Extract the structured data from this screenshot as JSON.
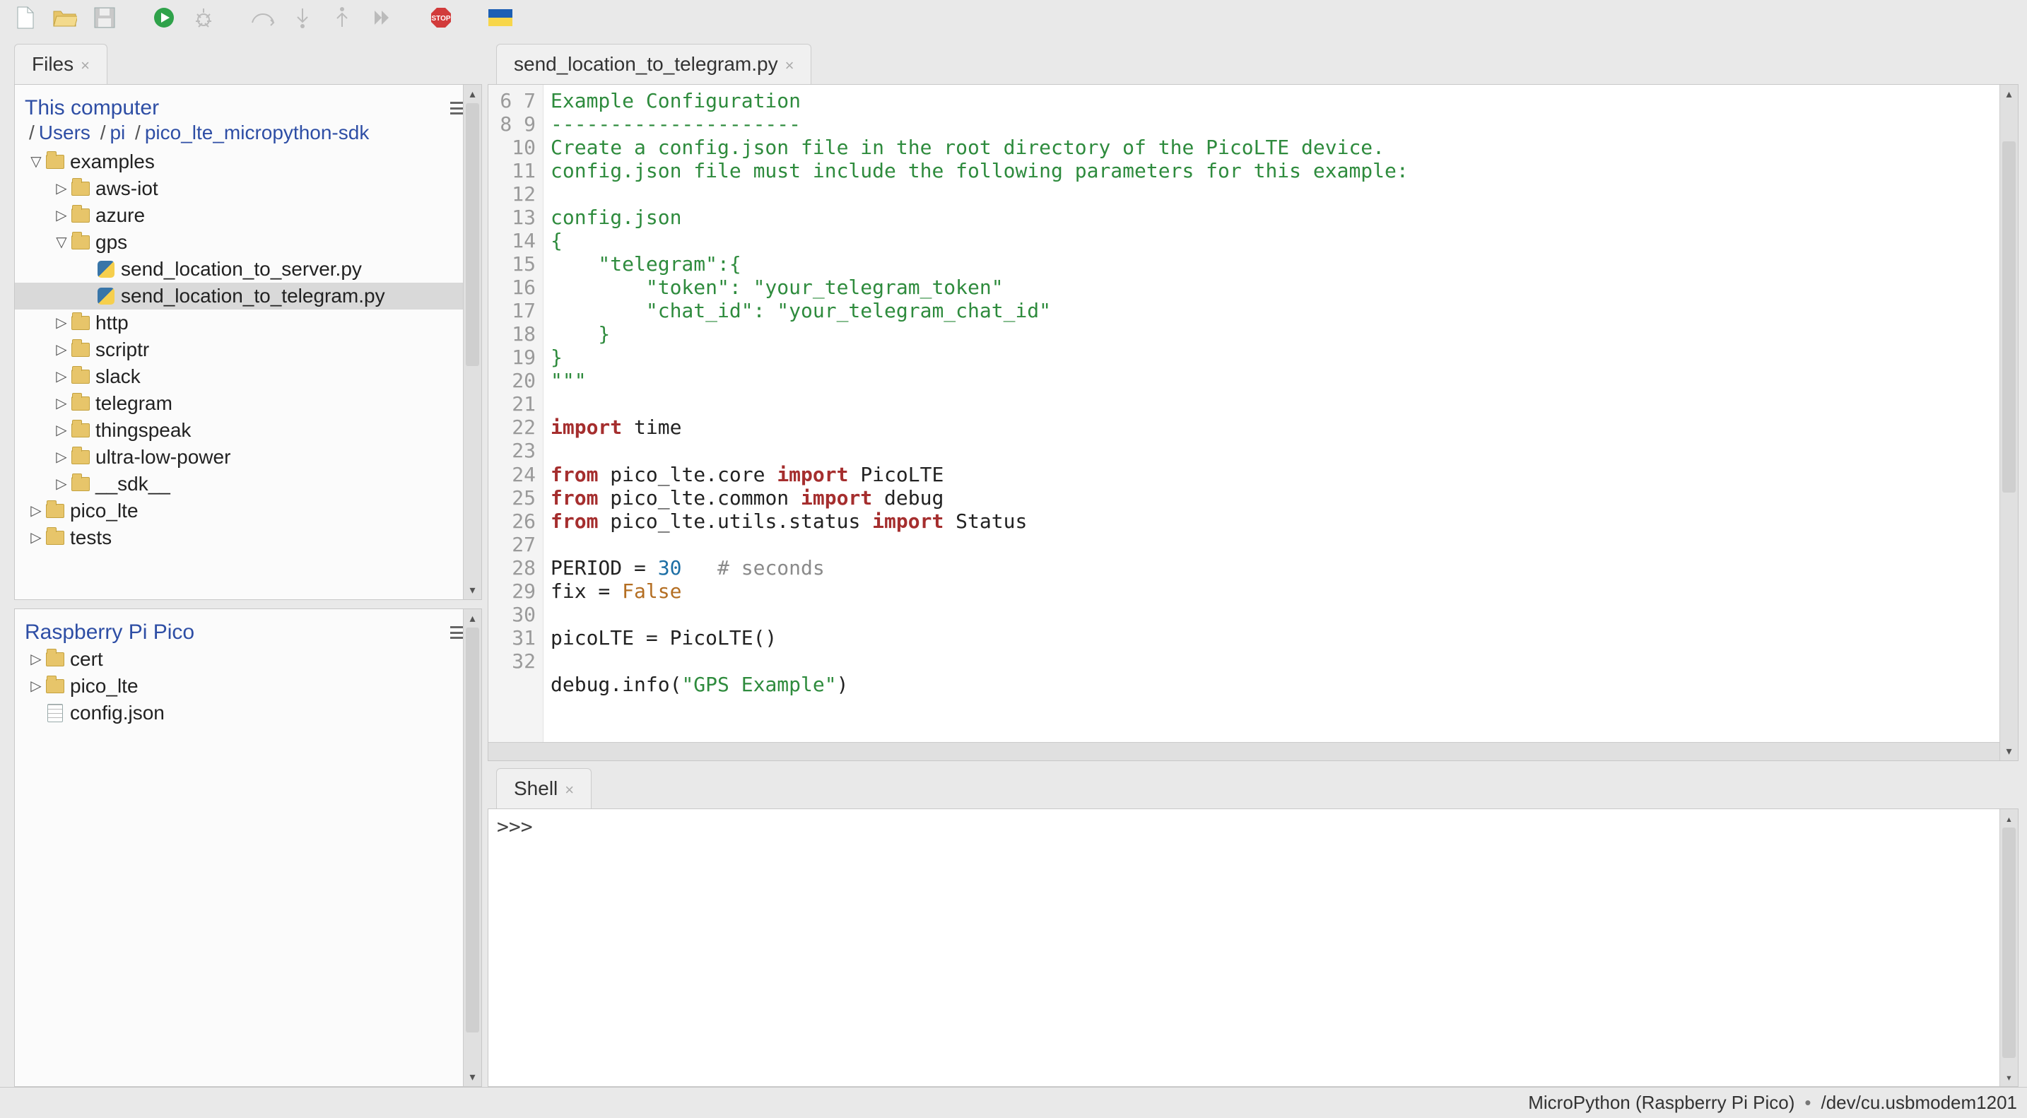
{
  "toolbar": {
    "icons": [
      "new-file",
      "open-file",
      "save-file",
      "run",
      "debug",
      "step-over",
      "step-into",
      "step-out",
      "resume",
      "stop",
      "flag"
    ]
  },
  "files_tab": "Files",
  "left_top": {
    "title": "This computer",
    "path": [
      "Users",
      "pi",
      "pico_lte_micropython-sdk"
    ],
    "tree": [
      {
        "d": 0,
        "arrow": "down",
        "icon": "folder",
        "label": "examples"
      },
      {
        "d": 1,
        "arrow": "right",
        "icon": "folder",
        "label": "aws-iot"
      },
      {
        "d": 1,
        "arrow": "right",
        "icon": "folder",
        "label": "azure"
      },
      {
        "d": 1,
        "arrow": "down",
        "icon": "folder",
        "label": "gps"
      },
      {
        "d": 2,
        "arrow": "",
        "icon": "py",
        "label": "send_location_to_server.py"
      },
      {
        "d": 2,
        "arrow": "",
        "icon": "py",
        "label": "send_location_to_telegram.py",
        "sel": true
      },
      {
        "d": 1,
        "arrow": "right",
        "icon": "folder",
        "label": "http"
      },
      {
        "d": 1,
        "arrow": "right",
        "icon": "folder",
        "label": "scriptr"
      },
      {
        "d": 1,
        "arrow": "right",
        "icon": "folder",
        "label": "slack"
      },
      {
        "d": 1,
        "arrow": "right",
        "icon": "folder",
        "label": "telegram"
      },
      {
        "d": 1,
        "arrow": "right",
        "icon": "folder",
        "label": "thingspeak"
      },
      {
        "d": 1,
        "arrow": "right",
        "icon": "folder",
        "label": "ultra-low-power"
      },
      {
        "d": 1,
        "arrow": "right",
        "icon": "folder",
        "label": "__sdk__"
      },
      {
        "d": 0,
        "arrow": "right",
        "icon": "folder",
        "label": "pico_lte"
      },
      {
        "d": 0,
        "arrow": "right",
        "icon": "folder",
        "label": "tests"
      }
    ]
  },
  "left_bot": {
    "title": "Raspberry Pi Pico",
    "tree": [
      {
        "d": 0,
        "arrow": "right",
        "icon": "folder",
        "label": "cert"
      },
      {
        "d": 0,
        "arrow": "right",
        "icon": "folder",
        "label": "pico_lte"
      },
      {
        "d": 0,
        "arrow": "",
        "icon": "txt",
        "label": "config.json"
      }
    ]
  },
  "editor": {
    "tab": "send_location_to_telegram.py",
    "first_line": 6,
    "lines": [
      [
        {
          "t": "Example Configuration",
          "c": "g"
        }
      ],
      [
        {
          "t": "---------------------",
          "c": "g"
        }
      ],
      [
        {
          "t": "Create a config.json file in the root directory of the PicoLTE device.",
          "c": "g"
        }
      ],
      [
        {
          "t": "config.json file must include the following parameters for this example:",
          "c": "g"
        }
      ],
      [],
      [
        {
          "t": "config.json",
          "c": "g"
        }
      ],
      [
        {
          "t": "{",
          "c": "g"
        }
      ],
      [
        {
          "t": "    \"telegram\":{",
          "c": "g"
        }
      ],
      [
        {
          "t": "        \"token\": \"your_telegram_token\"",
          "c": "g"
        }
      ],
      [
        {
          "t": "        \"chat_id\": \"your_telegram_chat_id\"",
          "c": "g"
        }
      ],
      [
        {
          "t": "    }",
          "c": "g"
        }
      ],
      [
        {
          "t": "}",
          "c": "g"
        }
      ],
      [
        {
          "t": "\"\"\"",
          "c": "g"
        }
      ],
      [],
      [
        {
          "t": "import",
          "c": "k"
        },
        {
          "t": " time"
        }
      ],
      [],
      [
        {
          "t": "from",
          "c": "k"
        },
        {
          "t": " pico_lte.core "
        },
        {
          "t": "import",
          "c": "k"
        },
        {
          "t": " PicoLTE"
        }
      ],
      [
        {
          "t": "from",
          "c": "k"
        },
        {
          "t": " pico_lte.common "
        },
        {
          "t": "import",
          "c": "k"
        },
        {
          "t": " debug"
        }
      ],
      [
        {
          "t": "from",
          "c": "k"
        },
        {
          "t": " pico_lte.utils.status "
        },
        {
          "t": "import",
          "c": "k"
        },
        {
          "t": " Status"
        }
      ],
      [],
      [
        {
          "t": "PERIOD = "
        },
        {
          "t": "30",
          "c": "n"
        },
        {
          "t": "   "
        },
        {
          "t": "# seconds",
          "c": "c"
        }
      ],
      [
        {
          "t": "fix = "
        },
        {
          "t": "False",
          "c": "o"
        }
      ],
      [],
      [
        {
          "t": "picoLTE = PicoLTE()"
        }
      ],
      [],
      [
        {
          "t": "debug.info("
        },
        {
          "t": "\"GPS Example\"",
          "c": "s"
        },
        {
          "t": ")"
        }
      ],
      []
    ]
  },
  "shell": {
    "tab": "Shell",
    "prompt": ">>> "
  },
  "status": {
    "interpreter": "MicroPython (Raspberry Pi Pico)",
    "port": "/dev/cu.usbmodem1201"
  }
}
